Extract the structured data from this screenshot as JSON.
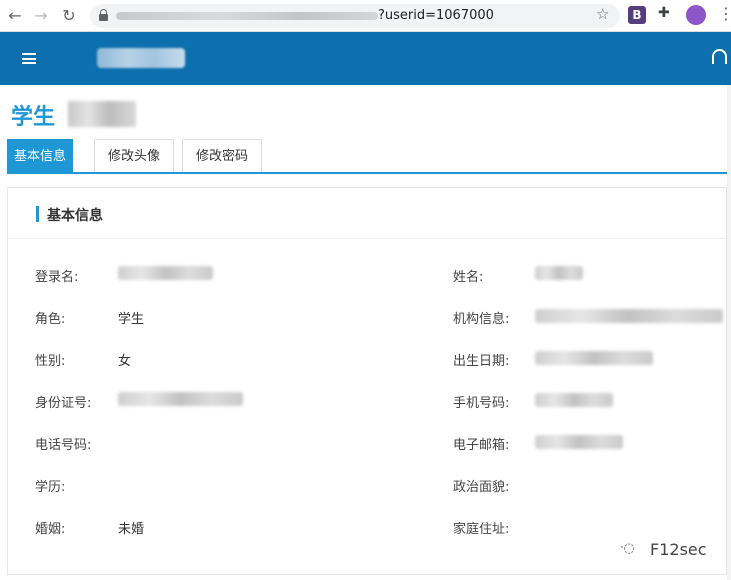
{
  "browser": {
    "back_icon": "arrow-left-icon",
    "forward_icon": "arrow-right-icon",
    "reload_icon": "reload-icon",
    "url_visible_suffix": "?userid=1067000",
    "bookmark_icon": "star-icon",
    "extension_b_label": "B",
    "extensions_icon": "puzzle-icon",
    "menu_icon": "kebab-icon"
  },
  "header": {
    "menu_icon": "hamburger-icon",
    "notification_icon": "bell-icon"
  },
  "page": {
    "title": "学生"
  },
  "tabs": [
    {
      "label": "基本信息",
      "active": true
    },
    {
      "label": "修改头像",
      "active": false
    },
    {
      "label": "修改密码",
      "active": false
    }
  ],
  "panel": {
    "title": "基本信息",
    "fields_left": [
      {
        "label": "登录名:",
        "value": ""
      },
      {
        "label": "角色:",
        "value": "学生"
      },
      {
        "label": "性别:",
        "value": "女"
      },
      {
        "label": "身份证号:",
        "value": ""
      },
      {
        "label": "电话号码:",
        "value": ""
      },
      {
        "label": "学历:",
        "value": ""
      },
      {
        "label": "婚姻:",
        "value": "未婚"
      }
    ],
    "fields_right": [
      {
        "label": "姓名:",
        "value": ""
      },
      {
        "label": "机构信息:",
        "value": ""
      },
      {
        "label": "出生日期:",
        "value": ""
      },
      {
        "label": "手机号码:",
        "value": ""
      },
      {
        "label": "电子邮箱:",
        "value": ""
      },
      {
        "label": "政治面貌:",
        "value": ""
      },
      {
        "label": "家庭住址:",
        "value": ""
      }
    ]
  },
  "watermark": {
    "text": "F12sec",
    "icon": "wechat-icon"
  },
  "colors": {
    "header_bg": "#0d6fae",
    "accent": "#1f97d4"
  }
}
